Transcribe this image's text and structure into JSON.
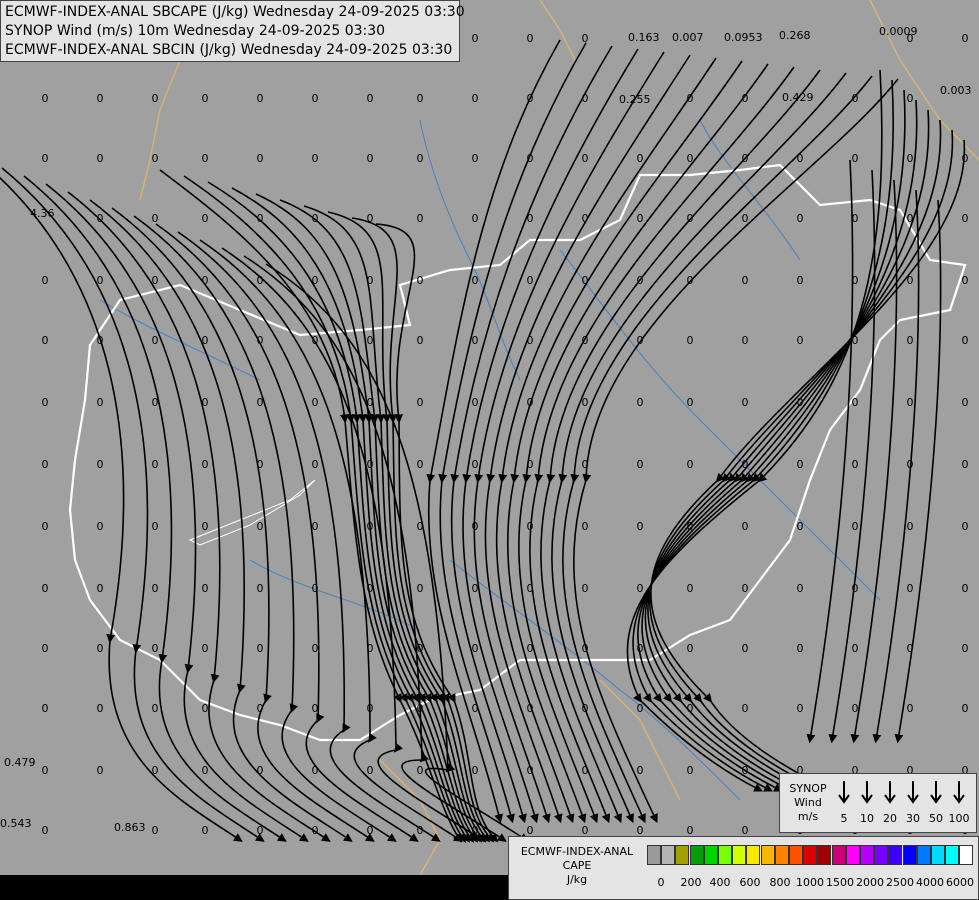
{
  "titles": [
    "ECMWF-INDEX-ANAL SBCAPE (J/kg) Wednesday 24-09-2025 03:30",
    "SYNOP Wind (m/s) 10m Wednesday 24-09-2025 03:30",
    "ECMWF-INDEX-ANAL SBCIN (J/kg) Wednesday 24-09-2025 03:30"
  ],
  "synop_legend": {
    "title": [
      "SYNOP",
      "Wind",
      "m/s"
    ],
    "values": [
      "5",
      "10",
      "20",
      "30",
      "50",
      "100"
    ]
  },
  "cape_legend": {
    "title": [
      "ECMWF-INDEX-ANAL",
      "CAPE",
      "J/kg"
    ],
    "colors": [
      "#9a9a9a",
      "#b4b4b4",
      "#a0a000",
      "#00a000",
      "#00d200",
      "#78ff00",
      "#d2ff00",
      "#ffe600",
      "#ffb400",
      "#ff8200",
      "#ff5000",
      "#dc0000",
      "#a00000",
      "#c80078",
      "#ff00ff",
      "#b400ff",
      "#7800ff",
      "#3c00ff",
      "#0000ff",
      "#0078ff",
      "#00dcff",
      "#00ffff",
      "#ffffff"
    ],
    "ticks": [
      "0",
      "200",
      "400",
      "600",
      "800",
      "1000",
      "1500",
      "2000",
      "2500",
      "4000",
      "6000"
    ]
  },
  "map_colors": {
    "background": "#a0a0a0",
    "border": "#ffffff",
    "coast": "#d4b27c",
    "river": "#4a7fc0",
    "streamline": "#000000"
  },
  "grid_values": [
    {
      "t": "0.163",
      "lon": 628,
      "lat": 37
    },
    {
      "t": "0.007",
      "lon": 672,
      "lat": 37
    },
    {
      "t": "0.0953",
      "lon": 724,
      "lat": 37
    },
    {
      "t": "0.268",
      "lon": 779,
      "lat": 35
    },
    {
      "t": "0.0009",
      "lon": 879,
      "lat": 31
    },
    {
      "t": "0.255",
      "lon": 619,
      "lat": 99
    },
    {
      "t": "0.429",
      "lon": 782,
      "lat": 97
    },
    {
      "t": "0.003",
      "lon": 940,
      "lat": 90
    },
    {
      "t": "4.36",
      "lon": 30,
      "lat": 213
    },
    {
      "t": "0.479",
      "lon": 4,
      "lat": 762
    },
    {
      "t": "0.543",
      "lon": 0,
      "lat": 823
    },
    {
      "t": "0.863",
      "lon": 114,
      "lat": 827
    }
  ],
  "zeros": {
    "cols": [
      45,
      100,
      155,
      205,
      260,
      315,
      370,
      420,
      475,
      530,
      585,
      640,
      690,
      745,
      800,
      855,
      910,
      965
    ],
    "rows": [
      38,
      98,
      158,
      218,
      280,
      340,
      402,
      464,
      526,
      588,
      648,
      708,
      770,
      830
    ]
  }
}
